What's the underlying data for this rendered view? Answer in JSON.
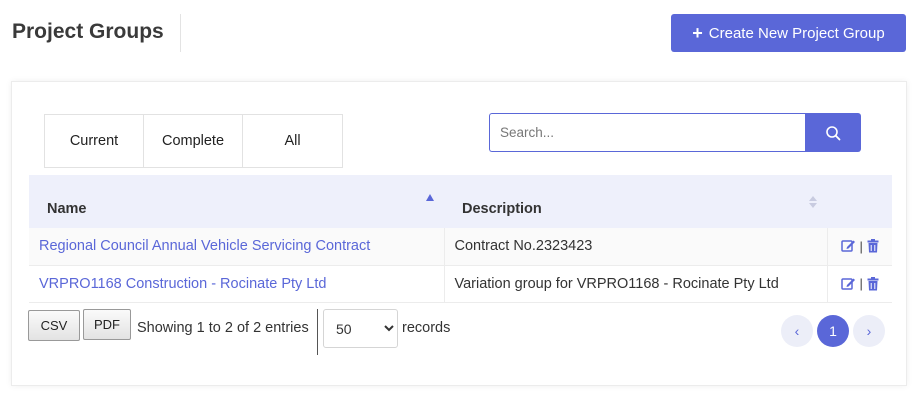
{
  "header": {
    "title": "Project Groups",
    "create_button": "Create New Project Group"
  },
  "filters": {
    "tabs": [
      "Current",
      "Complete",
      "All"
    ]
  },
  "search": {
    "placeholder": "Search...",
    "value": ""
  },
  "table": {
    "columns": [
      "Name",
      "Description"
    ],
    "rows": [
      {
        "name": "Regional Council Annual Vehicle Servicing Contract",
        "description": "Contract No.2323423"
      },
      {
        "name": "VRPRO1168 Construction - Rocinate Pty Ltd",
        "description": "Variation group for VRPRO1168 - Rocinate Pty Ltd"
      }
    ],
    "action_separator": "|"
  },
  "footer": {
    "csv_label": "CSV",
    "pdf_label": "PDF",
    "entries_info": "Showing 1 to 2 of 2 entries",
    "page_size": "50",
    "records_label": "records",
    "current_page": "1",
    "prev_icon": "‹",
    "next_icon": "›"
  },
  "colors": {
    "accent": "#5a67d8",
    "header_bg": "#eef0fb"
  },
  "icons": {
    "plus": "plus-icon",
    "search": "search-icon",
    "edit": "edit-icon",
    "delete": "trash-icon"
  }
}
